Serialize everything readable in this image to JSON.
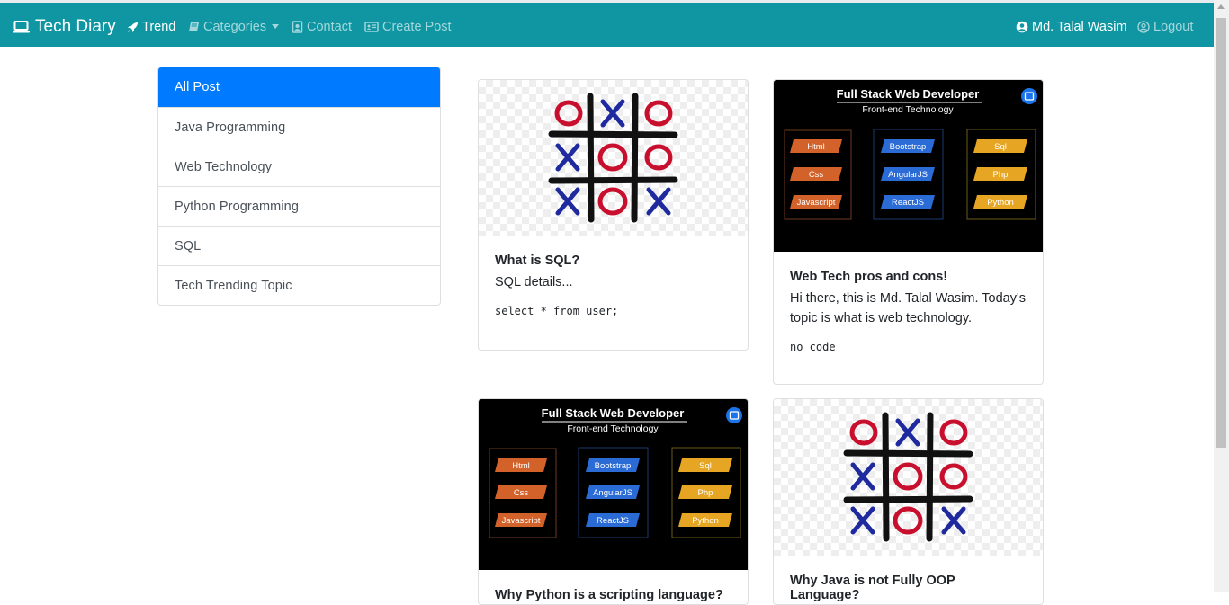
{
  "navbar": {
    "brand": "Tech Diary",
    "links": {
      "trend": "Trend",
      "categories": "Categories",
      "contact": "Contact",
      "create_post": "Create Post"
    },
    "user": "Md. Talal Wasim",
    "logout": "Logout",
    "bg_color": "#0f96a2"
  },
  "sidebar": {
    "items": [
      {
        "label": "All Post",
        "active": true
      },
      {
        "label": "Java Programming"
      },
      {
        "label": "Web Technology"
      },
      {
        "label": "Python Programming"
      },
      {
        "label": "SQL"
      },
      {
        "label": "Tech Trending Topic"
      }
    ],
    "active_color": "#007bff"
  },
  "banner": {
    "title": "Full Stack Web Developer",
    "subtitle": "Front-end Technology",
    "left": [
      "Html",
      "Css",
      "Javascript"
    ],
    "middle": [
      "Bootstrap",
      "AngularJS",
      "ReactJS"
    ],
    "right": [
      "Sql",
      "Php",
      "Python"
    ]
  },
  "posts": [
    {
      "title": "What is SQL?",
      "text": "SQL details...",
      "code": "select * from user;",
      "image": "tic-tac-toe"
    },
    {
      "title": "Web Tech pros and cons!",
      "text": "Hi there, this is Md. Talal Wasim. Today's topic is what is web technology.",
      "code": "no code",
      "image": "full-stack-banner"
    },
    {
      "title": "Why Python is a scripting language?",
      "image": "full-stack-banner"
    },
    {
      "title": "Why Java is not Fully OOP Language?",
      "image": "tic-tac-toe"
    }
  ]
}
